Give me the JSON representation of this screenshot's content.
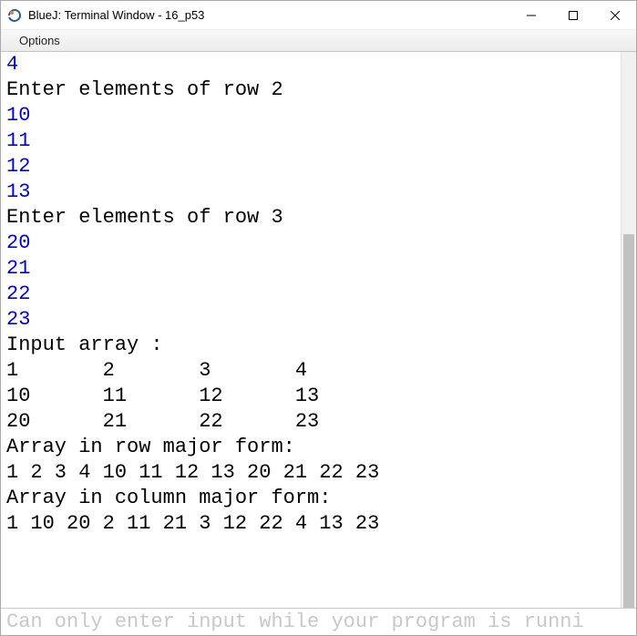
{
  "window": {
    "title": "BlueJ: Terminal Window - 16_p53"
  },
  "menubar": {
    "options": "Options"
  },
  "terminal": {
    "lines": [
      {
        "text": "4",
        "input": true
      },
      {
        "text": "Enter elements of row 2",
        "input": false
      },
      {
        "text": "10",
        "input": true
      },
      {
        "text": "11",
        "input": true
      },
      {
        "text": "12",
        "input": true
      },
      {
        "text": "13",
        "input": true
      },
      {
        "text": "Enter elements of row 3",
        "input": false
      },
      {
        "text": "20",
        "input": true
      },
      {
        "text": "21",
        "input": true
      },
      {
        "text": "22",
        "input": true
      },
      {
        "text": "23",
        "input": true
      },
      {
        "text": "Input array :",
        "input": false
      },
      {
        "text": "1       2       3       4",
        "input": false
      },
      {
        "text": "10      11      12      13",
        "input": false
      },
      {
        "text": "20      21      22      23",
        "input": false
      },
      {
        "text": "Array in row major form:",
        "input": false
      },
      {
        "text": "1 2 3 4 10 11 12 13 20 21 22 23",
        "input": false
      },
      {
        "text": "Array in column major form:",
        "input": false
      },
      {
        "text": "1 10 20 2 11 21 3 12 22 4 13 23",
        "input": false
      }
    ]
  },
  "statusbar": {
    "hint": "Can only enter input while your program is runni"
  }
}
